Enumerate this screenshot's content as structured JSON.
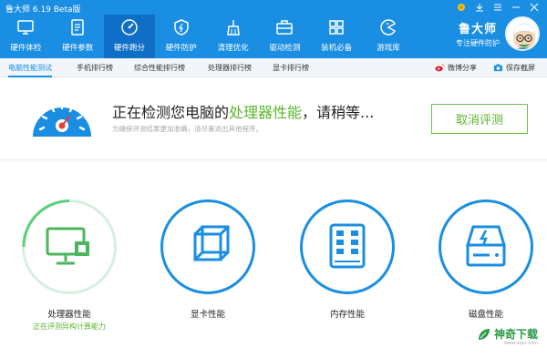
{
  "app": {
    "title": "鲁大师 6.19 Beta版"
  },
  "nav": [
    {
      "label": "硬件体检",
      "icon": "monitor-icon"
    },
    {
      "label": "硬件参数",
      "icon": "document-icon"
    },
    {
      "label": "硬件跑分",
      "icon": "speedometer-icon",
      "active": true
    },
    {
      "label": "硬件防护",
      "icon": "shield-icon"
    },
    {
      "label": "清理优化",
      "icon": "broom-icon"
    },
    {
      "label": "驱动检测",
      "icon": "toolbox-icon"
    },
    {
      "label": "装机必备",
      "icon": "apps-grid-icon"
    },
    {
      "label": "游戏库",
      "icon": "pacman-icon"
    }
  ],
  "brand": {
    "name": "鲁大师",
    "slogan": "专注硬件防护"
  },
  "subtabs": [
    "电脑性能测试",
    "手机排行榜",
    "综合性能排行榜",
    "处理器排行榜",
    "显卡排行榜"
  ],
  "actions": {
    "share": "微博分享",
    "screenshot": "保存截屏"
  },
  "status": {
    "prefix": "正在检测您电脑的",
    "highlight": "处理器性能",
    "suffix": "，请稍等...",
    "hint": "为确保评测结果更加准确，请尽量退出其他程序。",
    "cancel_label": "取消评测"
  },
  "tests": [
    {
      "label": "处理器性能",
      "sub": "正在评测异构计算能力",
      "icon": "cpu-monitor-icon",
      "state": "running"
    },
    {
      "label": "显卡性能",
      "sub": "",
      "icon": "cube-icon",
      "state": "pending"
    },
    {
      "label": "内存性能",
      "sub": "",
      "icon": "memory-chip-icon",
      "state": "pending"
    },
    {
      "label": "磁盘性能",
      "sub": "",
      "icon": "disk-icon",
      "state": "pending"
    }
  ],
  "watermark": {
    "text": "神奇下载",
    "url": "www.sqxz.com"
  },
  "colors": {
    "primary": "#1a8ee2",
    "accent_green": "#5bb62c",
    "active_tab": "#0f6fc6"
  }
}
